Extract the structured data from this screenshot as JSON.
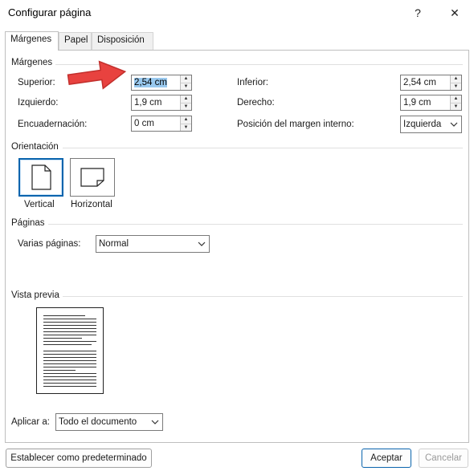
{
  "window": {
    "title": "Configurar página",
    "help_glyph": "?",
    "close_glyph": "✕"
  },
  "tabs": [
    {
      "label": "Márgenes",
      "active": true
    },
    {
      "label": "Papel",
      "active": false
    },
    {
      "label": "Disposición",
      "active": false
    }
  ],
  "margins": {
    "section_label": "Márgenes",
    "top": {
      "label": "Superior:",
      "value": "2,54 cm"
    },
    "bottom": {
      "label": "Inferior:",
      "value": "2,54 cm"
    },
    "left": {
      "label": "Izquierdo:",
      "value": "1,9 cm"
    },
    "right": {
      "label": "Derecho:",
      "value": "1,9 cm"
    },
    "gutter": {
      "label": "Encuadernación:",
      "value": "0 cm"
    },
    "gutter_position": {
      "label": "Posición del margen interno:",
      "value": "Izquierda"
    }
  },
  "orientation": {
    "section_label": "Orientación",
    "vertical_label": "Vertical",
    "horizontal_label": "Horizontal",
    "selected": "vertical"
  },
  "pages": {
    "section_label": "Páginas",
    "multiple_label": "Varias páginas:",
    "multiple_value": "Normal"
  },
  "preview": {
    "section_label": "Vista previa"
  },
  "apply": {
    "label": "Aplicar a:",
    "value": "Todo el documento"
  },
  "buttons": {
    "default_label": "Establecer como predeterminado",
    "ok_label": "Aceptar",
    "cancel_label": "Cancelar"
  },
  "colors": {
    "accent": "#0a64ad",
    "selection": "#99c9ef",
    "arrow": "#e8423f"
  }
}
